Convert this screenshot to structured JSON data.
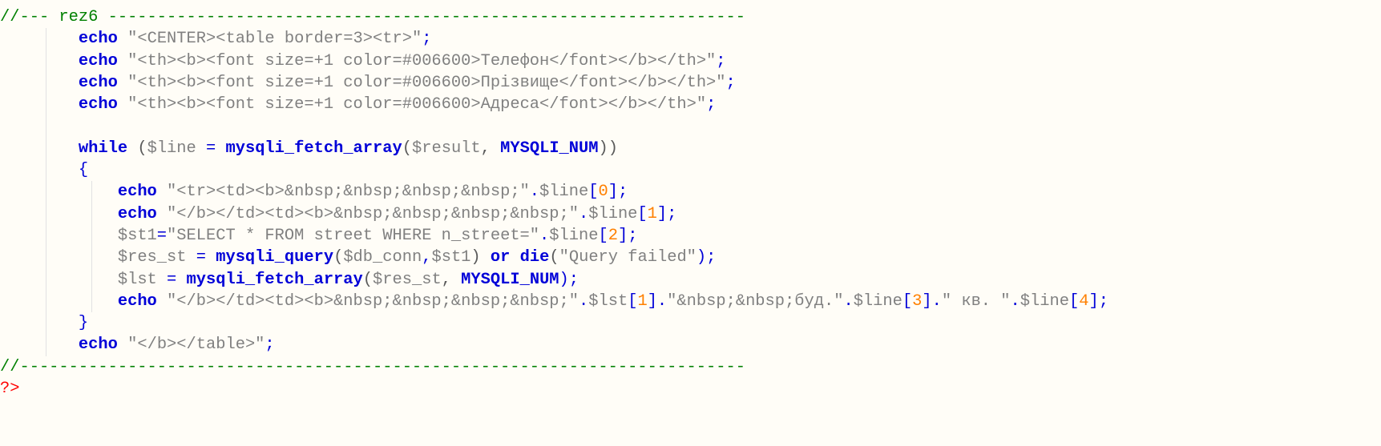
{
  "editor": {
    "language": "PHP",
    "lines": [
      {
        "indent": 0,
        "tokens": [
          {
            "t": "//--- rez6 -----------------------------------------------------------------",
            "c": "comment"
          }
        ]
      },
      {
        "indent": 2,
        "tokens": [
          {
            "t": "echo",
            "c": "kw"
          },
          {
            "t": " ",
            "c": "plain"
          },
          {
            "t": "\"<CENTER><table border=3><tr>\"",
            "c": "str"
          },
          {
            "t": ";",
            "c": "op"
          }
        ]
      },
      {
        "indent": 2,
        "tokens": [
          {
            "t": "echo",
            "c": "kw"
          },
          {
            "t": " ",
            "c": "plain"
          },
          {
            "t": "\"<th><b><font size=+1 color=#006600>Телефон</font></b></th>\"",
            "c": "str"
          },
          {
            "t": ";",
            "c": "op"
          }
        ]
      },
      {
        "indent": 2,
        "tokens": [
          {
            "t": "echo",
            "c": "kw"
          },
          {
            "t": " ",
            "c": "plain"
          },
          {
            "t": "\"<th><b><font size=+1 color=#006600>Прізвище</font></b></th>\"",
            "c": "str"
          },
          {
            "t": ";",
            "c": "op"
          }
        ]
      },
      {
        "indent": 2,
        "tokens": [
          {
            "t": "echo",
            "c": "kw"
          },
          {
            "t": " ",
            "c": "plain"
          },
          {
            "t": "\"<th><b><font size=+1 color=#006600>Адреса</font></b></th>\"",
            "c": "str"
          },
          {
            "t": ";",
            "c": "op"
          }
        ]
      },
      {
        "indent": 2,
        "tokens": []
      },
      {
        "indent": 2,
        "tokens": [
          {
            "t": "while",
            "c": "kw"
          },
          {
            "t": " (",
            "c": "paren"
          },
          {
            "t": "$line",
            "c": "var"
          },
          {
            "t": " = ",
            "c": "op"
          },
          {
            "t": "mysqli_fetch_array",
            "c": "fn"
          },
          {
            "t": "(",
            "c": "paren"
          },
          {
            "t": "$result",
            "c": "var"
          },
          {
            "t": ", ",
            "c": "plain"
          },
          {
            "t": "MYSQLI_NUM",
            "c": "const"
          },
          {
            "t": "))",
            "c": "paren"
          }
        ]
      },
      {
        "indent": 2,
        "tokens": [
          {
            "t": "{",
            "c": "op"
          }
        ]
      },
      {
        "indent": 3,
        "tokens": [
          {
            "t": "echo",
            "c": "kw"
          },
          {
            "t": " ",
            "c": "plain"
          },
          {
            "t": "\"<tr><td><b>&nbsp;&nbsp;&nbsp;&nbsp;\"",
            "c": "str"
          },
          {
            "t": ".",
            "c": "op"
          },
          {
            "t": "$line",
            "c": "var"
          },
          {
            "t": "[",
            "c": "op"
          },
          {
            "t": "0",
            "c": "num"
          },
          {
            "t": "];",
            "c": "op"
          }
        ]
      },
      {
        "indent": 3,
        "tokens": [
          {
            "t": "echo",
            "c": "kw"
          },
          {
            "t": " ",
            "c": "plain"
          },
          {
            "t": "\"</b></td><td><b>&nbsp;&nbsp;&nbsp;&nbsp;\"",
            "c": "str"
          },
          {
            "t": ".",
            "c": "op"
          },
          {
            "t": "$line",
            "c": "var"
          },
          {
            "t": "[",
            "c": "op"
          },
          {
            "t": "1",
            "c": "num"
          },
          {
            "t": "];",
            "c": "op"
          }
        ]
      },
      {
        "indent": 3,
        "tokens": [
          {
            "t": "$st1",
            "c": "var"
          },
          {
            "t": "=",
            "c": "op"
          },
          {
            "t": "\"SELECT * FROM street WHERE n_street=\"",
            "c": "str"
          },
          {
            "t": ".",
            "c": "op"
          },
          {
            "t": "$line",
            "c": "var"
          },
          {
            "t": "[",
            "c": "op"
          },
          {
            "t": "2",
            "c": "num"
          },
          {
            "t": "];",
            "c": "op"
          }
        ]
      },
      {
        "indent": 3,
        "tokens": [
          {
            "t": "$res_st",
            "c": "var"
          },
          {
            "t": " = ",
            "c": "op"
          },
          {
            "t": "mysqli_query",
            "c": "fn"
          },
          {
            "t": "(",
            "c": "paren"
          },
          {
            "t": "$db_conn",
            "c": "var"
          },
          {
            "t": ",",
            "c": "op"
          },
          {
            "t": "$st1",
            "c": "var"
          },
          {
            "t": ") ",
            "c": "paren"
          },
          {
            "t": "or",
            "c": "kw"
          },
          {
            "t": " ",
            "c": "plain"
          },
          {
            "t": "die",
            "c": "kw"
          },
          {
            "t": "(",
            "c": "paren"
          },
          {
            "t": "\"Query failed\"",
            "c": "str"
          },
          {
            "t": ");",
            "c": "op"
          }
        ]
      },
      {
        "indent": 3,
        "tokens": [
          {
            "t": "$lst",
            "c": "var"
          },
          {
            "t": " = ",
            "c": "op"
          },
          {
            "t": "mysqli_fetch_array",
            "c": "fn"
          },
          {
            "t": "(",
            "c": "paren"
          },
          {
            "t": "$res_st",
            "c": "var"
          },
          {
            "t": ", ",
            "c": "plain"
          },
          {
            "t": "MYSQLI_NUM",
            "c": "const"
          },
          {
            "t": ");",
            "c": "op"
          }
        ]
      },
      {
        "indent": 3,
        "tokens": [
          {
            "t": "echo",
            "c": "kw"
          },
          {
            "t": " ",
            "c": "plain"
          },
          {
            "t": "\"</b></td><td><b>&nbsp;&nbsp;&nbsp;&nbsp;\"",
            "c": "str"
          },
          {
            "t": ".",
            "c": "op"
          },
          {
            "t": "$lst",
            "c": "var"
          },
          {
            "t": "[",
            "c": "op"
          },
          {
            "t": "1",
            "c": "num"
          },
          {
            "t": "].",
            "c": "op"
          },
          {
            "t": "\"&nbsp;&nbsp;буд.\"",
            "c": "str"
          },
          {
            "t": ".",
            "c": "op"
          },
          {
            "t": "$line",
            "c": "var"
          },
          {
            "t": "[",
            "c": "op"
          },
          {
            "t": "3",
            "c": "num"
          },
          {
            "t": "].",
            "c": "op"
          },
          {
            "t": "\" кв. \"",
            "c": "str"
          },
          {
            "t": ".",
            "c": "op"
          },
          {
            "t": "$line",
            "c": "var"
          },
          {
            "t": "[",
            "c": "op"
          },
          {
            "t": "4",
            "c": "num"
          },
          {
            "t": "];",
            "c": "op"
          }
        ]
      },
      {
        "indent": 2,
        "tokens": [
          {
            "t": "}",
            "c": "op"
          }
        ]
      },
      {
        "indent": 2,
        "tokens": [
          {
            "t": "echo",
            "c": "kw"
          },
          {
            "t": " ",
            "c": "plain"
          },
          {
            "t": "\"</b></table>\"",
            "c": "str"
          },
          {
            "t": ";",
            "c": "op"
          }
        ]
      },
      {
        "indent": 0,
        "tokens": [
          {
            "t": "//--------------------------------------------------------------------------",
            "c": "comment"
          }
        ]
      },
      {
        "indent": 0,
        "tokens": [
          {
            "t": "?>",
            "c": "php"
          }
        ]
      }
    ]
  },
  "colors": {
    "background": "#fffdf7",
    "keyword": "#0000d8",
    "comment": "#008000",
    "string": "#808080",
    "number": "#ff8000",
    "php_tag": "#ff0000",
    "indent_guide": "#e2e2e2"
  },
  "icons": []
}
